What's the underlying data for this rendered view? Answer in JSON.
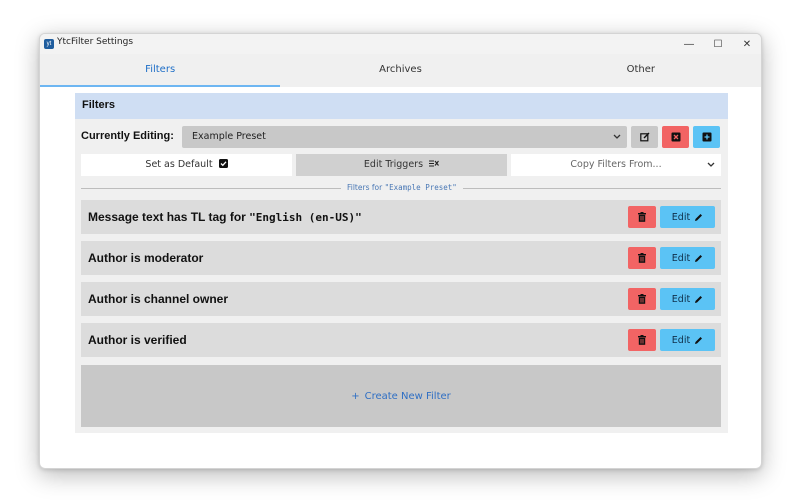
{
  "window": {
    "title": "YtcFilter Settings",
    "app_icon_glyph": "yt",
    "controls": {
      "minimize": "—",
      "maximize": "☐",
      "close": "✕"
    }
  },
  "tabs": [
    {
      "label": "Filters",
      "active": true
    },
    {
      "label": "Archives",
      "active": false
    },
    {
      "label": "Other",
      "active": false
    }
  ],
  "panel": {
    "heading": "Filters",
    "currently_editing_label": "Currently Editing:",
    "preset_value": "Example Preset",
    "preset_dropdown_icon": "chevron-down-icon",
    "preset_buttons": [
      {
        "name": "rename-preset",
        "icon": "edit-icon",
        "color": "#c8c8c8"
      },
      {
        "name": "delete-preset",
        "icon": "x-square-icon",
        "color": "#f26464"
      },
      {
        "name": "add-preset",
        "icon": "plus-square-icon",
        "color": "#5bc3f5"
      }
    ],
    "set_default_label": "Set as Default",
    "edit_triggers_label": "Edit Triggers",
    "copy_filters_label": "Copy Filters From...",
    "divider_label_prefix": "Filters for",
    "divider_label_value": "\"Example Preset\""
  },
  "filters": [
    {
      "title": "Message text has TL tag for",
      "mono": "\"English (en-US)\""
    },
    {
      "title": "Author is moderator",
      "mono": ""
    },
    {
      "title": "Author is channel owner",
      "mono": ""
    },
    {
      "title": "Author is verified",
      "mono": ""
    }
  ],
  "filter_actions": {
    "edit_label": "Edit"
  },
  "create": {
    "plus": "+",
    "label": "Create New Filter"
  },
  "colors": {
    "accent": "#1e6ec7",
    "danger": "#f26464",
    "info": "#5bc3f5",
    "panel_head": "#cfdef3"
  }
}
